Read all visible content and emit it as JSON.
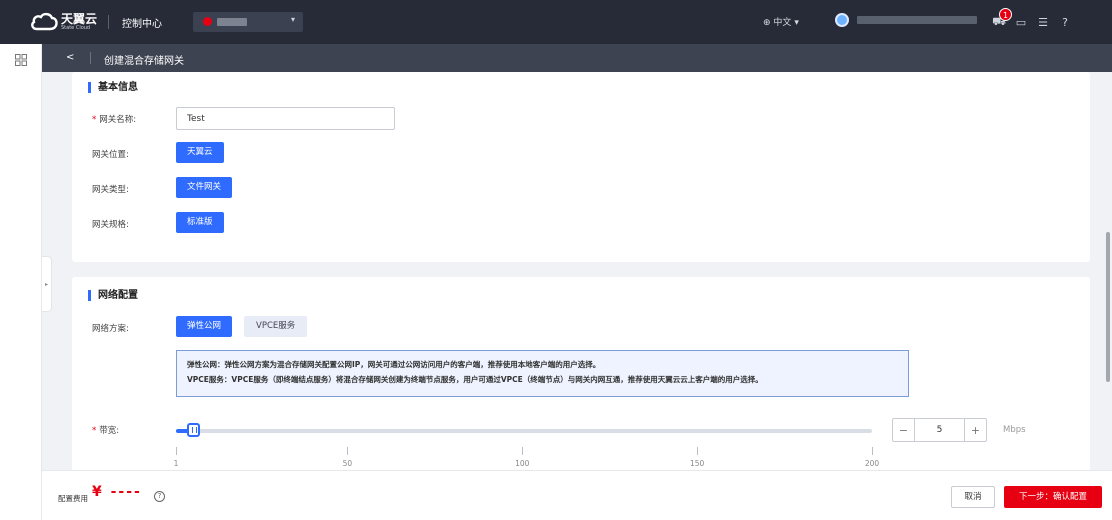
{
  "brand": {
    "name_cn": "天翼云",
    "name_en": "State Cloud"
  },
  "topbar": {
    "console": "控制中心",
    "language": "中文",
    "notification_count": "1"
  },
  "subheader": {
    "back": "<",
    "title": "创建混合存储网关"
  },
  "basic_info": {
    "section_title": "基本信息",
    "gateway_name_label": "网关名称:",
    "gateway_name_value": "Test",
    "location_label": "网关位置:",
    "location_value": "天翼云",
    "type_label": "网关类型:",
    "type_value": "文件网关",
    "spec_label": "网关规格:",
    "spec_value": "标准版"
  },
  "network": {
    "section_title": "网络配置",
    "plan_label": "网络方案:",
    "plan_options": [
      "弹性公网",
      "VPCE服务"
    ],
    "plan_selected": "弹性公网",
    "info_line1": "弹性公网：弹性公网方案为混合存储网关配置公网IP，网关可通过公网访问用户的客户端，推荐使用本地客户端的用户选择。",
    "info_line2": "VPCE服务：VPCE服务（即终端结点服务）将混合存储网关创建为终端节点服务，用户可通过VPCE（终端节点）与网关内网互通，推荐使用天翼云云上客户端的用户选择。",
    "bandwidth_label": "带宽:",
    "bandwidth_value": "5",
    "bandwidth_min": 1,
    "bandwidth_max": 200,
    "bandwidth_unit": "Mbps",
    "slider_ticks": [
      "1",
      "50",
      "100",
      "150",
      "200"
    ]
  },
  "footer": {
    "fee_label": "配置费用",
    "fee_value": "¥ ----",
    "cancel": "取消",
    "next": "下一步：确认配置"
  },
  "colors": {
    "topbar": "#262b37",
    "primary": "#2f6bff",
    "danger": "#e60012"
  }
}
